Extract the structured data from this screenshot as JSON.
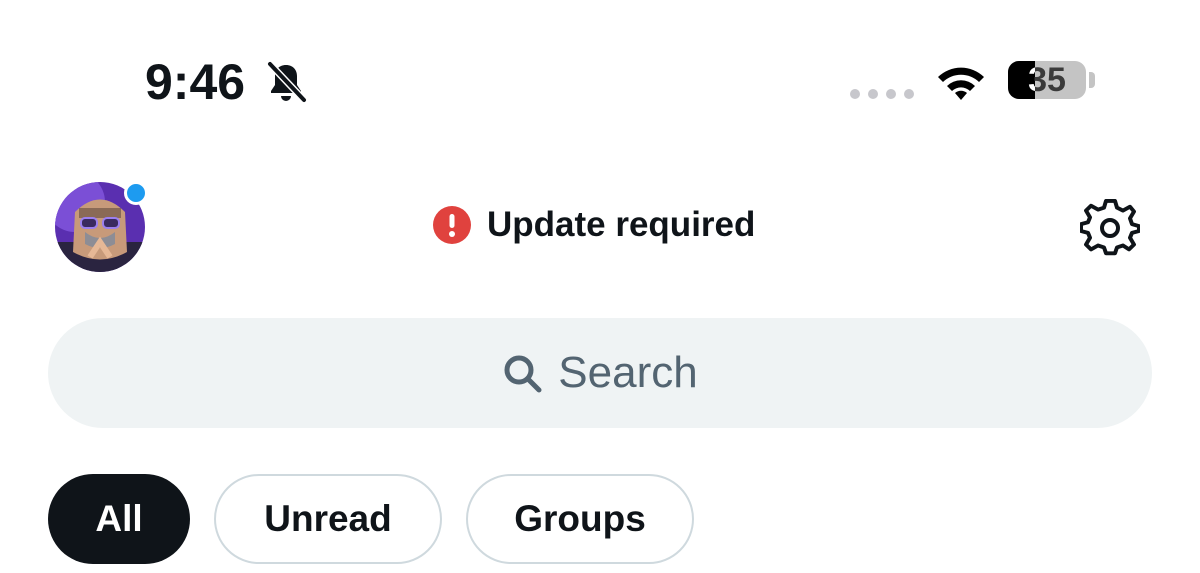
{
  "status_bar": {
    "time": "9:46",
    "battery_percent": "35",
    "battery_level": 0.35,
    "icons": [
      "bell-slash-icon",
      "signal-dots-icon",
      "wifi-icon",
      "battery-icon"
    ]
  },
  "header": {
    "update_label": "Update required",
    "alert_color": "#e0423e",
    "presence_color": "#1d9bf0",
    "settings_icon": "gear-icon"
  },
  "search": {
    "placeholder": "Search"
  },
  "tabs": [
    {
      "label": "All",
      "active": true
    },
    {
      "label": "Unread",
      "active": false
    },
    {
      "label": "Groups",
      "active": false
    }
  ]
}
